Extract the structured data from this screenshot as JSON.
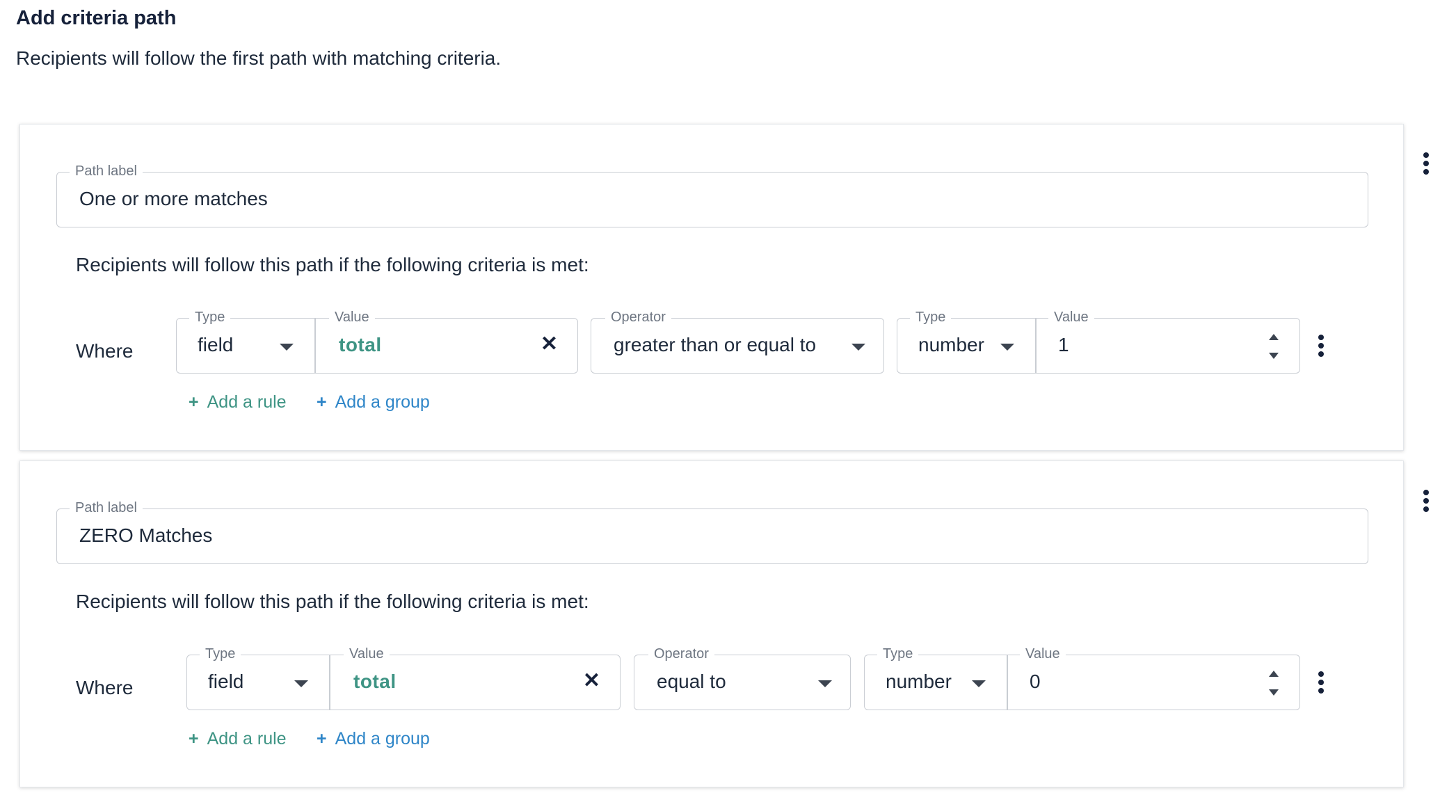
{
  "header": {
    "title": "Add criteria path",
    "subtitle": "Recipients will follow the first path with matching criteria."
  },
  "paths": [
    {
      "path_label_caption": "Path label",
      "path_label_value": "One or more matches",
      "criteria_text": "Recipients will follow this path if the following criteria is met:",
      "where_label": "Where",
      "rule": {
        "left_type_label": "Type",
        "left_type_value": "field",
        "left_value_label": "Value",
        "left_value": "total",
        "operator_label": "Operator",
        "operator_value": "greater than or equal to",
        "right_type_label": "Type",
        "right_type_value": "number",
        "right_value_label": "Value",
        "right_value": "1"
      },
      "add_rule_label": "Add a rule",
      "add_group_label": "Add a group"
    },
    {
      "path_label_caption": "Path label",
      "path_label_value": "ZERO Matches",
      "criteria_text": "Recipients will follow this path if the following criteria is met:",
      "where_label": "Where",
      "rule": {
        "left_type_label": "Type",
        "left_type_value": "field",
        "left_value_label": "Value",
        "left_value": "total",
        "operator_label": "Operator",
        "operator_value": "equal to",
        "right_type_label": "Type",
        "right_type_value": "number",
        "right_value_label": "Value",
        "right_value": "0"
      },
      "add_rule_label": "Add a rule",
      "add_group_label": "Add a group"
    }
  ],
  "icons": {
    "plus": "+",
    "clear": "✕",
    "more": "more-vertical-icon",
    "dropdown": "caret-down-icon",
    "stepper": "number-stepper-icon"
  },
  "colors": {
    "accent_teal": "#3e9484",
    "link_blue": "#2f86c8",
    "text_dark": "#1e2a3b",
    "border": "#c9cdd3"
  }
}
